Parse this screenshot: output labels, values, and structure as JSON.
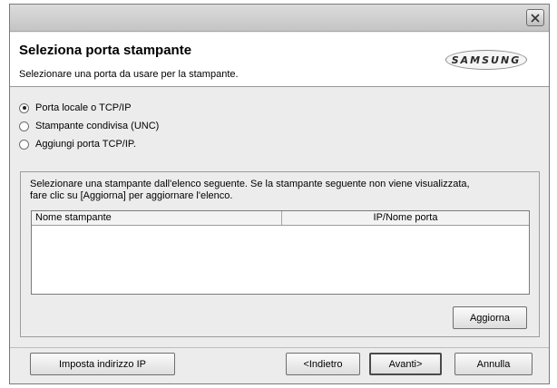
{
  "window": {
    "close_icon": "close-icon"
  },
  "header": {
    "title": "Seleziona porta stampante",
    "subtitle": "Selezionare una porta da usare per la stampante.",
    "logo_text": "SAMSUNG"
  },
  "port_options": [
    {
      "label": "Porta locale o TCP/IP",
      "checked": true
    },
    {
      "label": "Stampante condivisa (UNC)",
      "checked": false
    },
    {
      "label": "Aggiungi porta TCP/IP.",
      "checked": false
    }
  ],
  "printer_list": {
    "description_line1": "Selezionare una stampante dall'elenco seguente. Se la stampante seguente non viene visualizzata,",
    "description_line2": "fare clic su [Aggiorna] per aggiornare l'elenco.",
    "columns": [
      "Nome stampante",
      "IP/Nome porta"
    ],
    "rows": []
  },
  "buttons": {
    "refresh": "Aggiorna",
    "set_ip": "Imposta indirizzo IP",
    "back": "<Indietro",
    "next": "Avanti>",
    "cancel": "Annulla"
  },
  "colors": {
    "window_bg": "#ececec",
    "header_bg": "#ffffff",
    "titlebar": "#c4c4c4"
  }
}
